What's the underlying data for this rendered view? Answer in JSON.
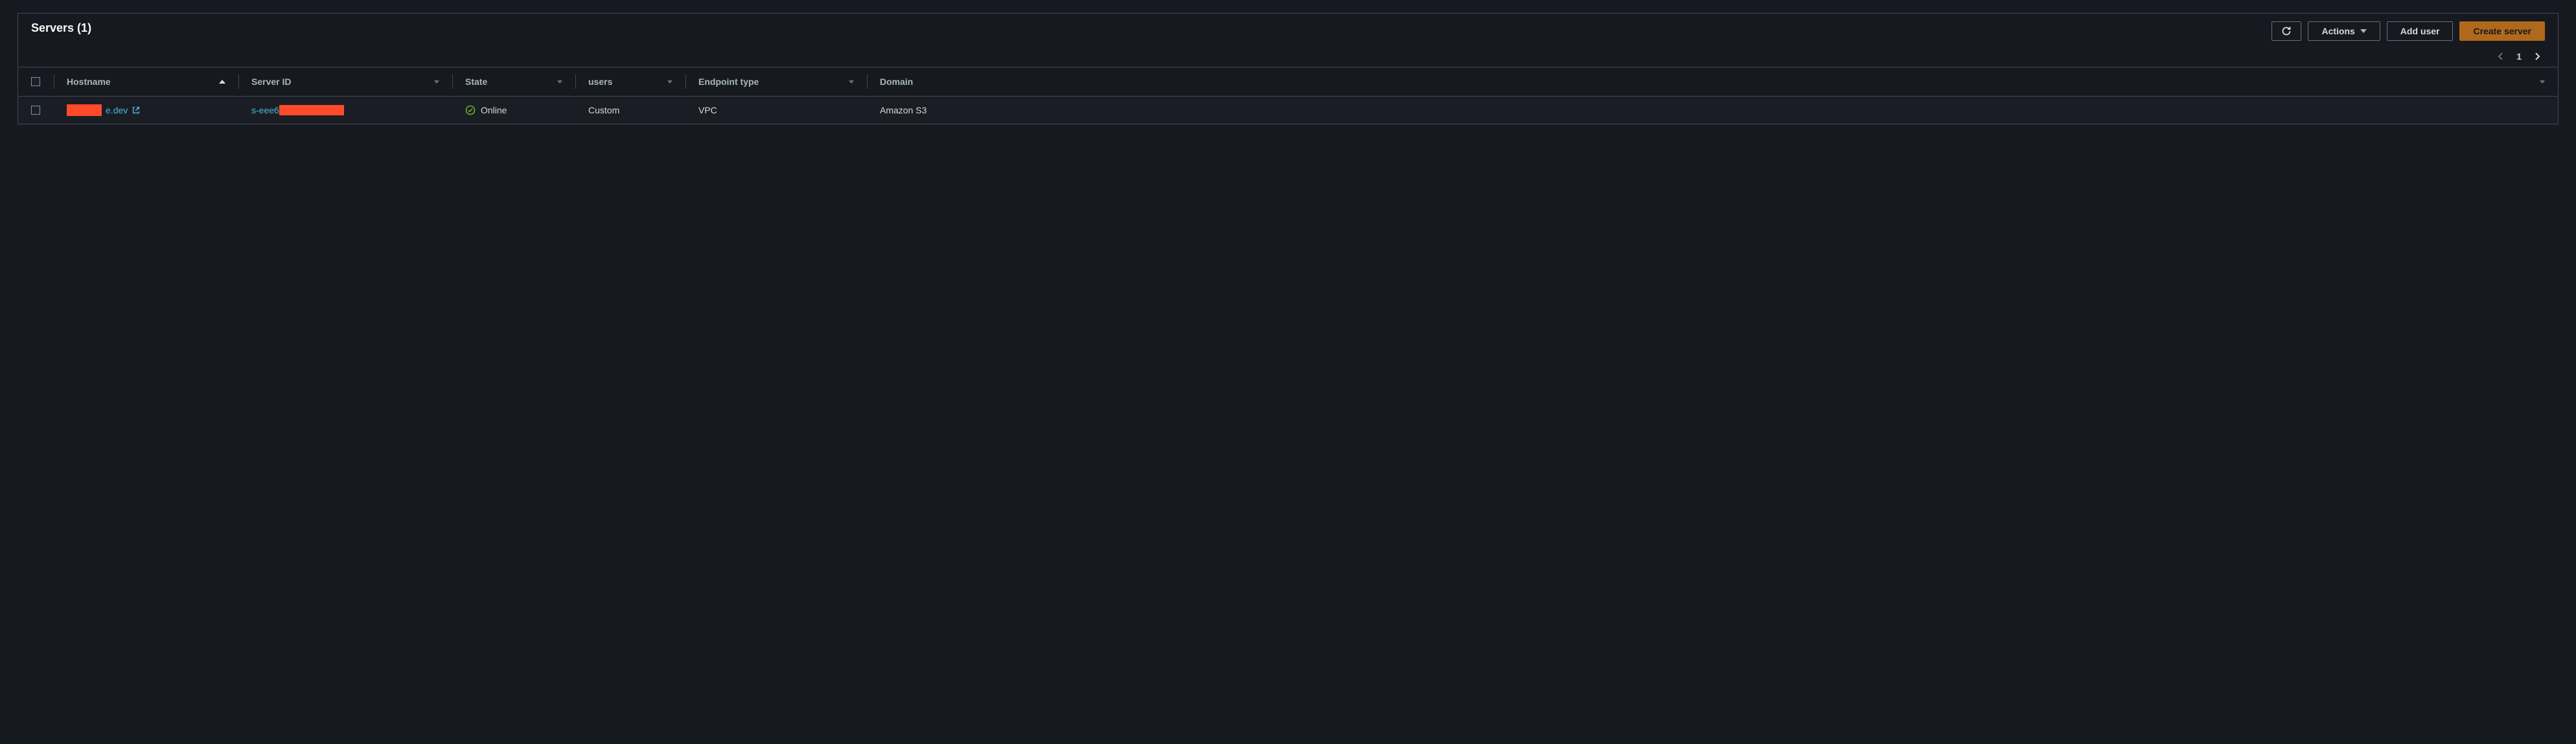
{
  "header": {
    "title": "Servers (1)",
    "actions_label": "Actions",
    "add_user_label": "Add user",
    "create_server_label": "Create server"
  },
  "pagination": {
    "current": "1"
  },
  "columns": {
    "hostname": "Hostname",
    "server_id": "Server ID",
    "state": "State",
    "users": "users",
    "endpoint_type": "Endpoint type",
    "domain": "Domain"
  },
  "rows": [
    {
      "hostname_visible_suffix": "e.dev",
      "server_id_prefix": "s-eee6",
      "state": "Online",
      "users": "Custom",
      "endpoint_type": "VPC",
      "domain": "Amazon S3"
    }
  ]
}
